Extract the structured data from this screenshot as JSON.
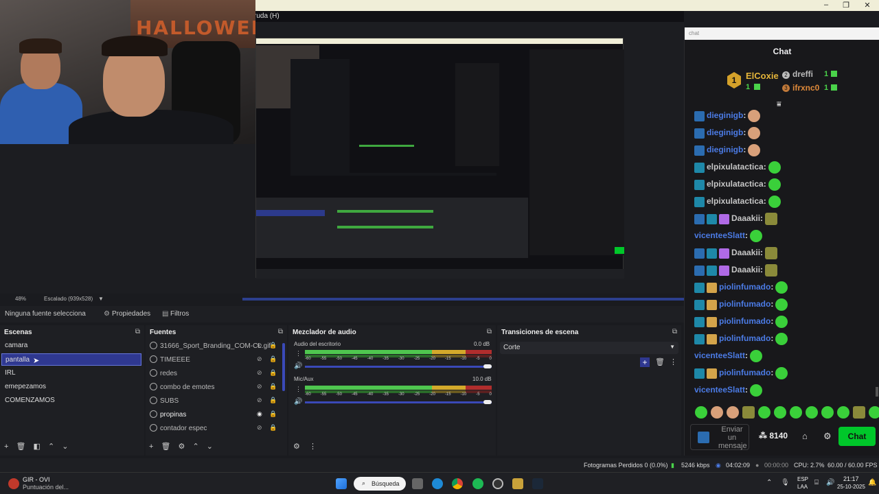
{
  "window": {
    "menu_fragment": "ruda (H)",
    "min": "–",
    "max": "❐",
    "close": "✕"
  },
  "preview": {
    "zoom": "48%",
    "scale_mode": "Escalado (939x528)"
  },
  "props_bar": {
    "no_source": "Ninguna fuente selecciona",
    "properties": "Propiedades",
    "filters": "Filtros"
  },
  "scenes": {
    "title": "Escenas",
    "items": [
      "camara",
      "pantalla",
      "IRL",
      "emepezamos",
      "COMENZAMOS"
    ],
    "selected": "pantalla"
  },
  "sources": {
    "title": "Fuentes",
    "items": [
      "31666_Sport_Branding_COM-CL.gif",
      "TIMEEEE",
      "redes",
      "combo de emotes",
      "SUBS",
      "propinas",
      "contador espec"
    ]
  },
  "mixer": {
    "title": "Mezclador de audio",
    "tracks": [
      {
        "name": "Audio del escritorio",
        "db": "0.0 dB"
      },
      {
        "name": "Mic/Aux",
        "db": "10.0 dB"
      }
    ],
    "ticks": [
      "-60",
      "-55",
      "-50",
      "-45",
      "-40",
      "-35",
      "-30",
      "-25",
      "-20",
      "-15",
      "-10",
      "-5",
      "0"
    ]
  },
  "transitions": {
    "title": "Transiciones de escena",
    "selected": "Corte"
  },
  "chat": {
    "input_placeholder": "chat",
    "title": "Chat",
    "leaderboard": [
      {
        "rank": "1",
        "name": "ElCoxie",
        "count": "1"
      },
      {
        "rank": "2",
        "name": "dreffi",
        "count": "1"
      },
      {
        "rank": "3",
        "name": "ifrxnc0",
        "count": "1"
      }
    ],
    "messages": [
      {
        "user": "dieginigb",
        "color": "#4b7be5",
        "emote": "face"
      },
      {
        "user": "dieginigb",
        "color": "#4b7be5",
        "emote": "face"
      },
      {
        "user": "dieginigb",
        "color": "#4b7be5",
        "emote": "face"
      },
      {
        "user": "elpixulatactica",
        "color": "#c6c6c6",
        "emote": "green"
      },
      {
        "user": "elpixulatactica",
        "color": "#c6c6c6",
        "emote": "green"
      },
      {
        "user": "elpixulatactica",
        "color": "#c6c6c6",
        "emote": "green"
      },
      {
        "user": "Daaakii",
        "color": "#c6c6c6",
        "emote": "box"
      },
      {
        "user": "vicenteeSlatt",
        "color": "#4b7be5",
        "emote": "green"
      },
      {
        "user": "Daaakii",
        "color": "#c6c6c6",
        "emote": "box"
      },
      {
        "user": "Daaakii",
        "color": "#c6c6c6",
        "emote": "box"
      },
      {
        "user": "piolinfumado",
        "color": "#4b7be5",
        "emote": "green"
      },
      {
        "user": "piolinfumado",
        "color": "#4b7be5",
        "emote": "green"
      },
      {
        "user": "piolinfumado",
        "color": "#4b7be5",
        "emote": "green"
      },
      {
        "user": "piolinfumado",
        "color": "#4b7be5",
        "emote": "green"
      },
      {
        "user": "vicenteeSlatt",
        "color": "#4b7be5",
        "emote": "green"
      },
      {
        "user": "piolinfumado",
        "color": "#4b7be5",
        "emote": "green"
      },
      {
        "user": "vicenteeSlatt",
        "color": "#4b7be5",
        "emote": "green"
      }
    ],
    "send_placeholder": "Enviar un mensaje",
    "points": "8140",
    "send_button": "Chat"
  },
  "status": {
    "dropped": "Fotogramas Perdidos 0 (0.0%)",
    "bitrate": "5246 kbps",
    "stream_time": "04:02:09",
    "rec_time": "00:00:00",
    "cpu": "CPU: 2.7%",
    "fps": "60.00 / 60.00 FPS"
  },
  "taskbar": {
    "app_title": "GIR - OVI",
    "app_sub": "Puntuación del...",
    "search": "Búsqueda",
    "lang": "ESP",
    "lang2": "LAA",
    "time": "21:17",
    "date": "25-10-2025"
  },
  "colors": {
    "accent": "#2f3890",
    "twitch_green": "#00c72a",
    "chat_bg": "#18181b"
  }
}
